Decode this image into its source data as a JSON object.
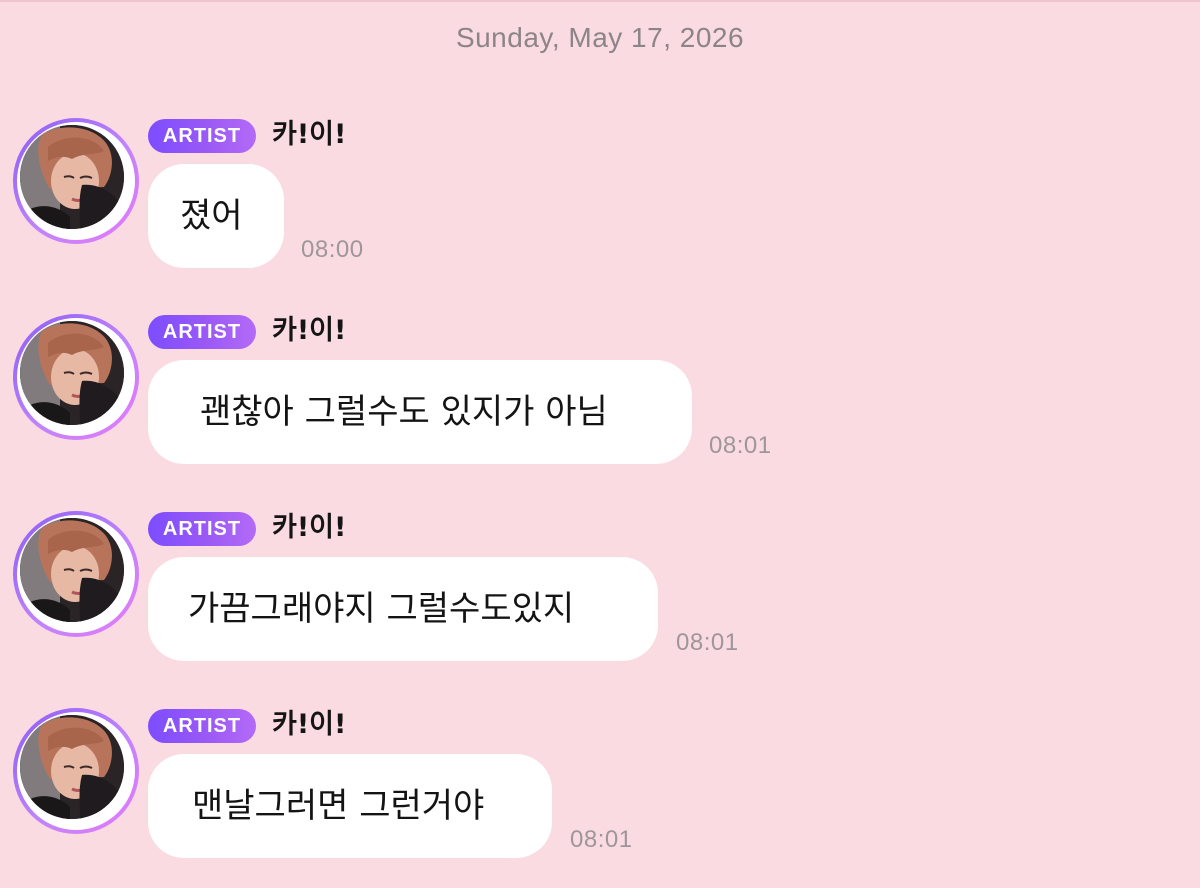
{
  "chat": {
    "date_header": "Sunday, May 17, 2026",
    "messages": [
      {
        "badge": "ARTIST",
        "sender": "카!이!",
        "text": "졌어",
        "time": "08:00"
      },
      {
        "badge": "ARTIST",
        "sender": "카!이!",
        "text": "괜찮아 그럴수도 있지가 아님",
        "time": "08:01"
      },
      {
        "badge": "ARTIST",
        "sender": "카!이!",
        "text": "가끔그래야지 그럴수도있지",
        "time": "08:01"
      },
      {
        "badge": "ARTIST",
        "sender": "카!이!",
        "text": "맨날그러면 그런거야",
        "time": "08:01"
      }
    ]
  },
  "colors": {
    "background": "#fadbe1",
    "badge_gradient_start": "#7c4dff",
    "badge_gradient_end": "#b36af7",
    "bubble": "#ffffff",
    "timestamp": "#9e979a"
  },
  "icons": {
    "avatar": "artist-profile-photo"
  }
}
